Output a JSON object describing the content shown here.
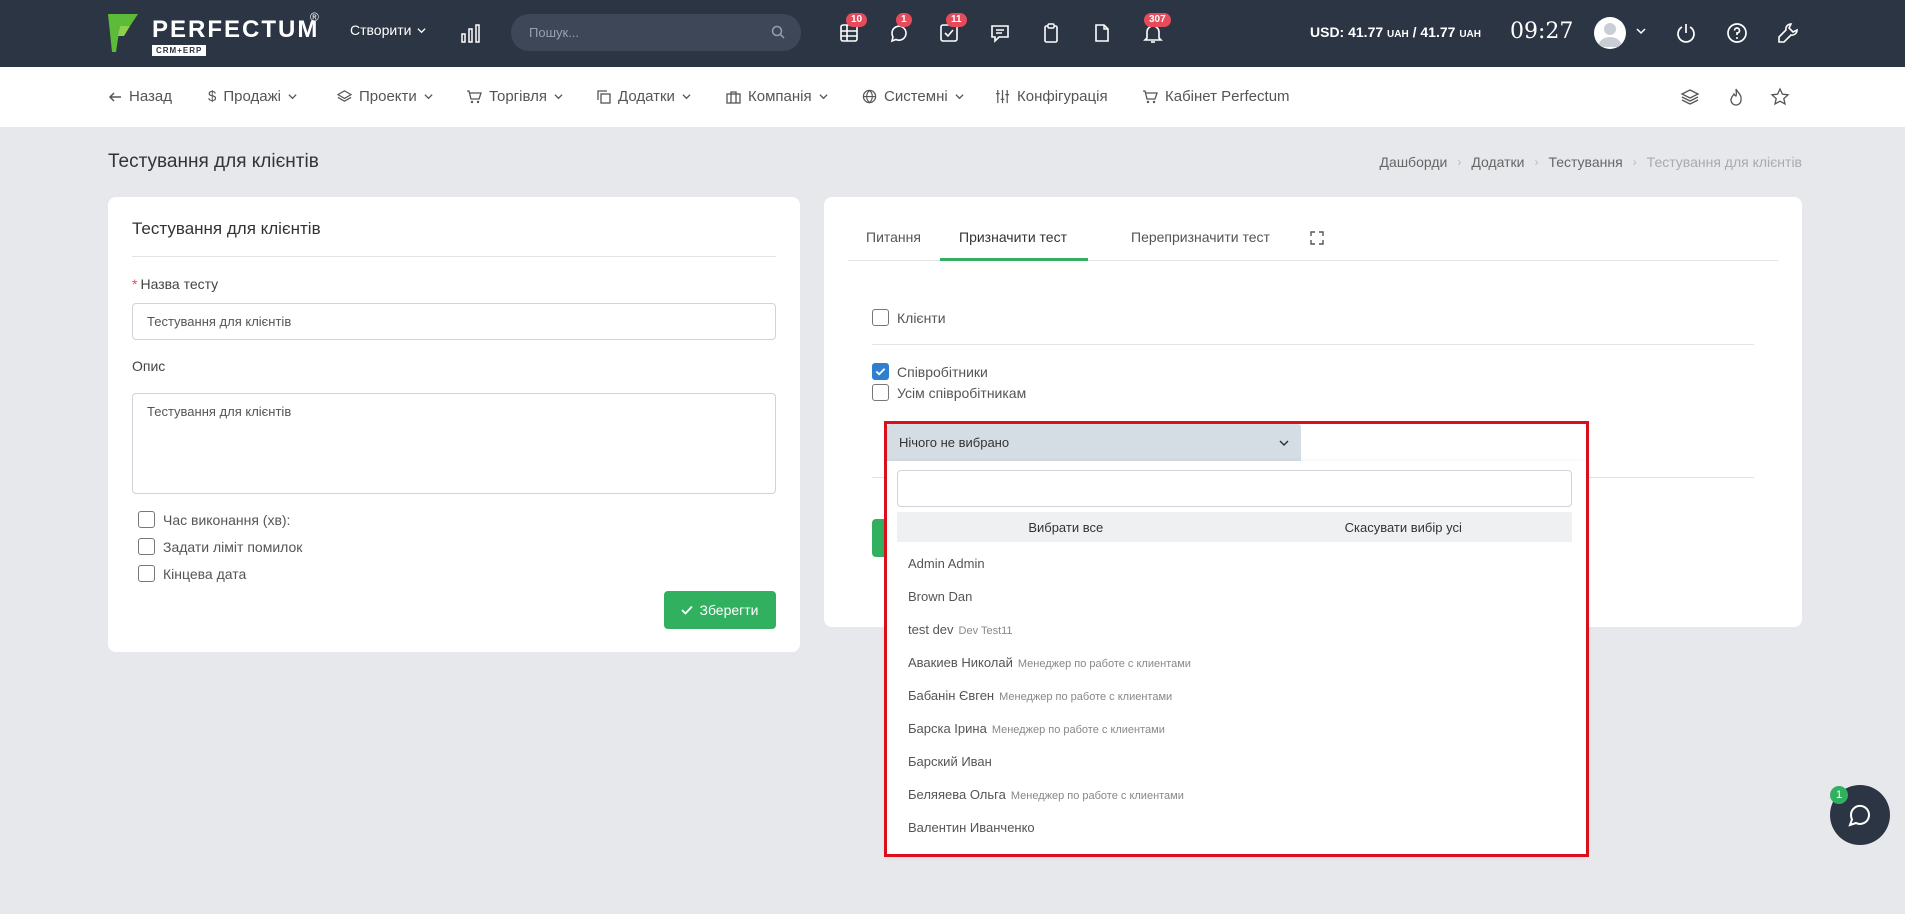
{
  "topbar": {
    "logo_text": "PERFECTUM",
    "logo_reg": "®",
    "logo_sub": "CRM+ERP",
    "create_label": "Створити",
    "search_placeholder": "Пошук...",
    "icons": [
      {
        "name": "table-icon",
        "badge": "10"
      },
      {
        "name": "chat-bubble-icon",
        "badge": "1"
      },
      {
        "name": "task-check-icon",
        "badge": "11"
      },
      {
        "name": "message-icon",
        "badge": ""
      },
      {
        "name": "clipboard-icon",
        "badge": ""
      },
      {
        "name": "file-icon",
        "badge": ""
      },
      {
        "name": "bell-icon",
        "badge": "307"
      }
    ],
    "currency_text": "USD: 41.77",
    "currency_unit1": "UAH",
    "currency_sep": " / 41.77",
    "currency_unit2": "UAH",
    "time": "09:27"
  },
  "nav": {
    "back": "Назад",
    "sales": "Продажі",
    "projects": "Проекти",
    "trade": "Торгівля",
    "addons": "Додатки",
    "company": "Компанія",
    "system": "Системні",
    "config": "Конфігурація",
    "cabinet": "Кабінет Perfectum"
  },
  "page": {
    "title": "Тестування для клієнтів",
    "breadcrumb": [
      "Дашборди",
      "Додатки",
      "Тестування",
      "Тестування для клієнтів"
    ]
  },
  "form": {
    "card_title": "Тестування для клієнтів",
    "name_required": "*",
    "name_label": "Назва тесту",
    "name_value": "Тестування для клієнтів",
    "desc_label": "Опис",
    "desc_value": "Тестування для клієнтів",
    "checkboxes": [
      "Час виконання (хв):",
      "Задати ліміт помилок",
      "Кінцева дата"
    ],
    "save_label": "Зберегти"
  },
  "assign": {
    "tabs": [
      "Питання",
      "Призначити тест",
      "Перепризначити тест"
    ],
    "active_tab": "Призначити тест",
    "clients_label": "Клієнти",
    "clients_checked": false,
    "employees_label": "Співробітники",
    "employees_checked": true,
    "all_employees_label": "Усім співробітникам",
    "all_employees_checked": false,
    "select_value": "Нічого не вибрано",
    "select_all": "Вибрати все",
    "deselect_all": "Скасувати вибір усі",
    "options": [
      {
        "name": "Admin Admin",
        "sub": ""
      },
      {
        "name": "Brown Dan",
        "sub": ""
      },
      {
        "name": "test dev",
        "sub": "Dev Test11"
      },
      {
        "name": "Авакиев Николай",
        "sub": "Менеджер по работе с клиентами"
      },
      {
        "name": "Бабанін Євген",
        "sub": "Менеджер по работе с клиентами"
      },
      {
        "name": "Барска Ірина",
        "sub": "Менеджер по работе с клиентами"
      },
      {
        "name": "Барский Иван",
        "sub": ""
      },
      {
        "name": "Беляяева Ольга",
        "sub": "Менеджер по работе с клиентами"
      },
      {
        "name": "Валентин Иванченко",
        "sub": ""
      }
    ]
  },
  "chat": {
    "badge": "1"
  },
  "colors": {
    "accent_green": "#31b15f",
    "topbar": "#2c3543",
    "badge_red": "#e54b5b",
    "highlight_red": "#d9101b",
    "checkbox_blue": "#2f7fd1"
  }
}
